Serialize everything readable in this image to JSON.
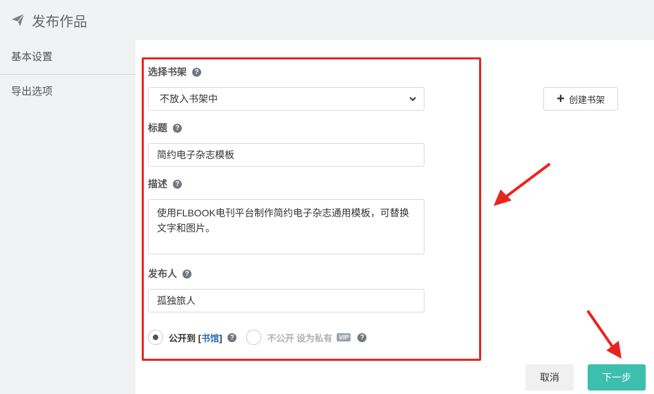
{
  "header": {
    "title": "发布作品",
    "icon": "paper-plane-icon"
  },
  "sidebar": {
    "items": [
      {
        "label": "基本设置",
        "active": true
      },
      {
        "label": "导出选项",
        "active": false
      }
    ]
  },
  "form": {
    "shelf": {
      "label": "选择书架",
      "selected": "不放入书架中"
    },
    "create_shelf_label": "创建书架",
    "title": {
      "label": "标题",
      "value": "简约电子杂志模板"
    },
    "description": {
      "label": "描述",
      "value": "使用FLBOOK电刊平台制作简约电子杂志通用模板，可替换文字和图片。"
    },
    "publisher": {
      "label": "发布人",
      "value": "孤独旅人"
    },
    "visibility": {
      "public_prefix": "公开到 [",
      "public_link": "书馆",
      "public_suffix": "]",
      "private_label": "不公开 设为私有",
      "vip_badge": "VIP",
      "selected": "public"
    }
  },
  "footer": {
    "cancel_label": "取消",
    "next_label": "下一步"
  },
  "colors": {
    "accent": "#3dbfae",
    "highlight": "#e8251d",
    "link": "#2a6ebb"
  }
}
